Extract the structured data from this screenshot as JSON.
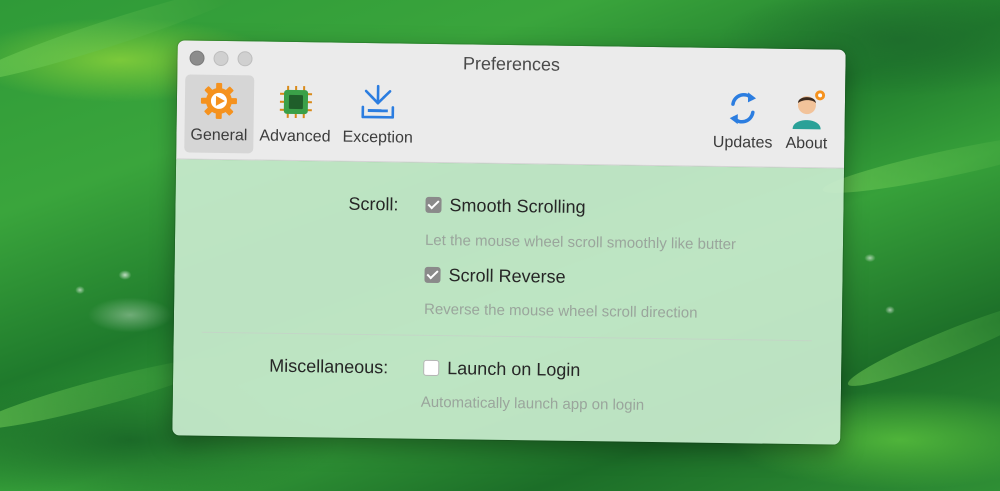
{
  "window": {
    "title": "Preferences"
  },
  "toolbar": {
    "tabs": [
      {
        "label": "General",
        "icon": "gear-play-icon",
        "active": true,
        "color": "#f5921e"
      },
      {
        "label": "Advanced",
        "icon": "cpu-chip-icon",
        "active": false,
        "color": "#2c8a3a"
      },
      {
        "label": "Exception",
        "icon": "download-tray-icon",
        "active": false,
        "color": "#2b7de0"
      }
    ],
    "right_tabs": [
      {
        "label": "Updates",
        "icon": "refresh-icon",
        "color": "#2b7de0"
      },
      {
        "label": "About",
        "icon": "person-icon",
        "color": "#2aa198"
      }
    ]
  },
  "settings": {
    "scroll": {
      "label": "Scroll:",
      "smooth": {
        "label": "Smooth Scrolling",
        "checked": true,
        "description": "Let the mouse wheel scroll smoothly like butter"
      },
      "reverse": {
        "label": "Scroll Reverse",
        "checked": true,
        "description": "Reverse the mouse wheel scroll direction"
      }
    },
    "misc": {
      "label": "Miscellaneous:",
      "launch": {
        "label": "Launch on Login",
        "checked": false,
        "description": "Automatically launch app on login"
      }
    }
  }
}
